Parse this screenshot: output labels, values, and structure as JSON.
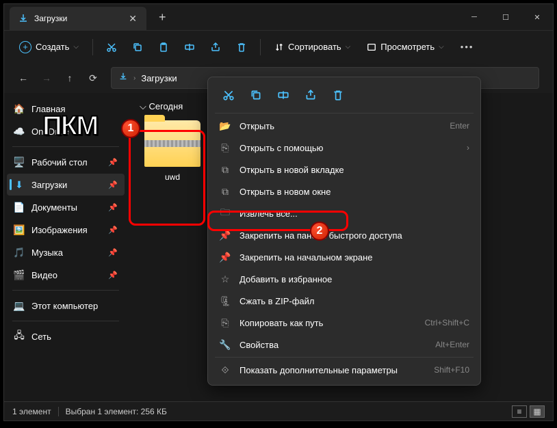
{
  "tab": {
    "title": "Загрузки"
  },
  "toolbar": {
    "create": "Создать",
    "sort": "Сортировать",
    "view": "Просмотреть"
  },
  "breadcrumb": {
    "current": "Загрузки"
  },
  "sidebar": {
    "home": "Главная",
    "onedrive": "OneDrive",
    "desktop": "Рабочий стол",
    "downloads": "Загрузки",
    "documents": "Документы",
    "pictures": "Изображения",
    "music": "Музыка",
    "videos": "Видео",
    "thispc": "Этот компьютер",
    "network": "Сеть"
  },
  "main": {
    "section": "Сегодня",
    "file_name": "uwd"
  },
  "context_menu": {
    "open": "Открыть",
    "open_hint": "Enter",
    "open_with": "Открыть с помощью",
    "new_tab": "Открыть в новой вкладке",
    "new_window": "Открыть в новом окне",
    "extract_all": "Извлечь все...",
    "pin_quick": "Закрепить на панели быстрого доступа",
    "pin_start": "Закрепить на начальном экране",
    "favorites": "Добавить в избранное",
    "compress": "Сжать в ZIP-файл",
    "copy_path": "Копировать как путь",
    "copy_path_hint": "Ctrl+Shift+C",
    "properties": "Свойства",
    "properties_hint": "Alt+Enter",
    "more_options": "Показать дополнительные параметры",
    "more_options_hint": "Shift+F10"
  },
  "statusbar": {
    "count": "1 элемент",
    "selection": "Выбран 1 элемент: 256 КБ"
  },
  "annotation": {
    "pkm": "ПКМ",
    "m1": "1",
    "m2": "2"
  }
}
